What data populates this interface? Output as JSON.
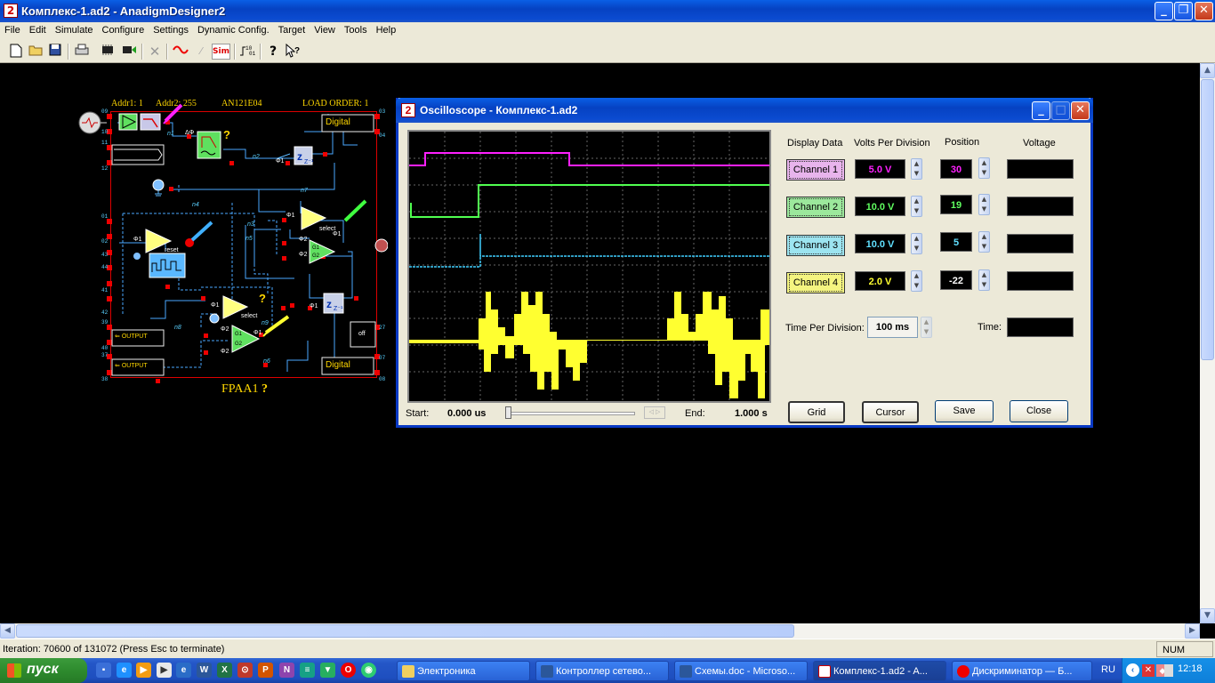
{
  "window": {
    "title": "Комплекс-1.ad2 - AnadigmDesigner2",
    "icon": "anadigm-icon"
  },
  "menu": [
    "File",
    "Edit",
    "Simulate",
    "Configure",
    "Settings",
    "Dynamic Config.",
    "Target",
    "View",
    "Tools",
    "Help"
  ],
  "toolbar": {
    "sim_label": "Sim",
    "bits_label": "10\n01",
    "help_glyph": "?"
  },
  "fpaa": {
    "addr1": "Addr1: 1",
    "addr2": "Addr2: 255",
    "chip": "AN121E04",
    "load_order": "LOAD ORDER: 1",
    "name": "FPAA1",
    "qmark": "?",
    "digital_label": "Digital",
    "output_label": "OUTPUT",
    "select_label": "select",
    "reset_label": "reset",
    "off_label": "off",
    "phi1": "Φ1",
    "phi2": "Φ2",
    "dphi": "ΔΦ",
    "z_label": "Z⁻¹",
    "g1": "G1",
    "g2": "G2",
    "pins_left": [
      "09",
      "10",
      "11",
      "12",
      "01",
      "02",
      "43",
      "44",
      "41",
      "42",
      "39",
      "40",
      "37",
      "38"
    ],
    "pins_right": [
      "03",
      "04",
      "27",
      "07",
      "08"
    ],
    "wire_tags": [
      "n1",
      "n2",
      "n7",
      "n4",
      "n5",
      "n3",
      "n8",
      "n6",
      "n9"
    ]
  },
  "oscilloscope": {
    "title": "Oscilloscope - Комплекс-1.ad2",
    "headers": {
      "display": "Display Data",
      "volts": "Volts Per Division",
      "position": "Position",
      "voltage": "Voltage"
    },
    "channels": [
      {
        "label": "Channel 1",
        "volts": "5.0 V",
        "position": "30",
        "color": "#ff00ff",
        "bg": "#e8b4ec"
      },
      {
        "label": "Channel 2",
        "volts": "10.0 V",
        "position": "19",
        "color": "#60ff60",
        "bg": "#9ce89c"
      },
      {
        "label": "Channel 3",
        "volts": "10.0 V",
        "position": "5",
        "color": "#60e0ff",
        "bg": "#9ce4f0"
      },
      {
        "label": "Channel 4",
        "volts": "2.0 V",
        "position": "-22",
        "color": "#ffff30",
        "bg": "#f4f480"
      }
    ],
    "time_per_division_label": "Time Per Division:",
    "time_per_division": "100 ms",
    "time_label": "Time:",
    "start_label": "Start:",
    "start_value": "0.000 us",
    "end_label": "End:",
    "end_value": "1.000 s",
    "buttons": {
      "grid": "Grid",
      "cursor": "Cursor",
      "save": "Save",
      "close": "Close"
    }
  },
  "status": {
    "text": "Iteration:  70600 of 131072 (Press Esc to terminate)",
    "num": "NUM"
  },
  "taskbar": {
    "start": "пуск",
    "tasks": [
      "Электроника",
      "Контроллер сетево...",
      "Схемы.doc - Microso...",
      "Комплекс-1.ad2 - A...",
      "Дискриминатор — Б..."
    ],
    "lang": "RU",
    "clock": "12:18"
  }
}
